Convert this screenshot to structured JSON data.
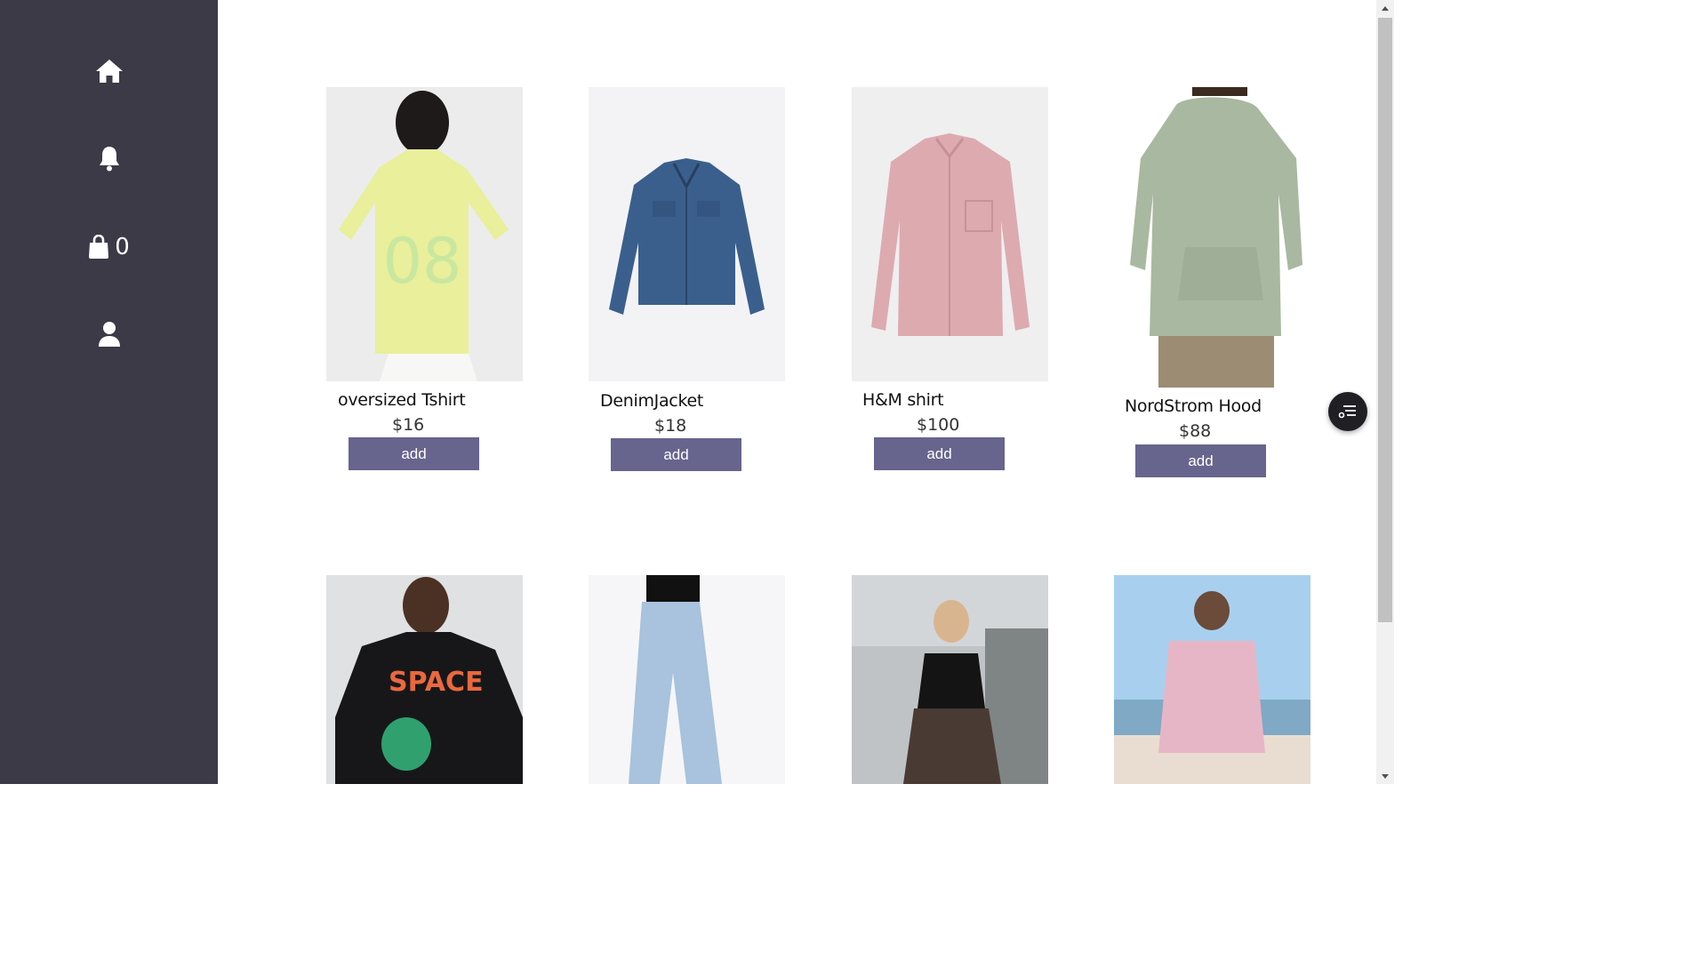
{
  "sidebar": {
    "items": [
      {
        "icon": "home-icon"
      },
      {
        "icon": "bell-icon"
      },
      {
        "icon": "shopping-bag-icon",
        "count": "0"
      },
      {
        "icon": "user-icon"
      }
    ]
  },
  "products": [
    {
      "name": "oversized Tshirt",
      "price": "$16",
      "button": "add"
    },
    {
      "name": "DenimJacket",
      "price": "$18",
      "button": "add"
    },
    {
      "name": "H&M shirt",
      "price": "$100",
      "button": "add"
    },
    {
      "name": "NordStrom Hood",
      "price": "$88",
      "button": "add"
    }
  ],
  "second_row": [
    {
      "image": "black graphic t-shirt photo"
    },
    {
      "image": "light wash jeans photo"
    },
    {
      "image": "floral skirt street style photo"
    },
    {
      "image": "pink hoodie beach photo"
    }
  ],
  "fab": {
    "icon": "filter-list-icon"
  },
  "colors": {
    "sidebar": "#3c3a47",
    "button": "#67648e",
    "fab": "#1f1f24"
  }
}
